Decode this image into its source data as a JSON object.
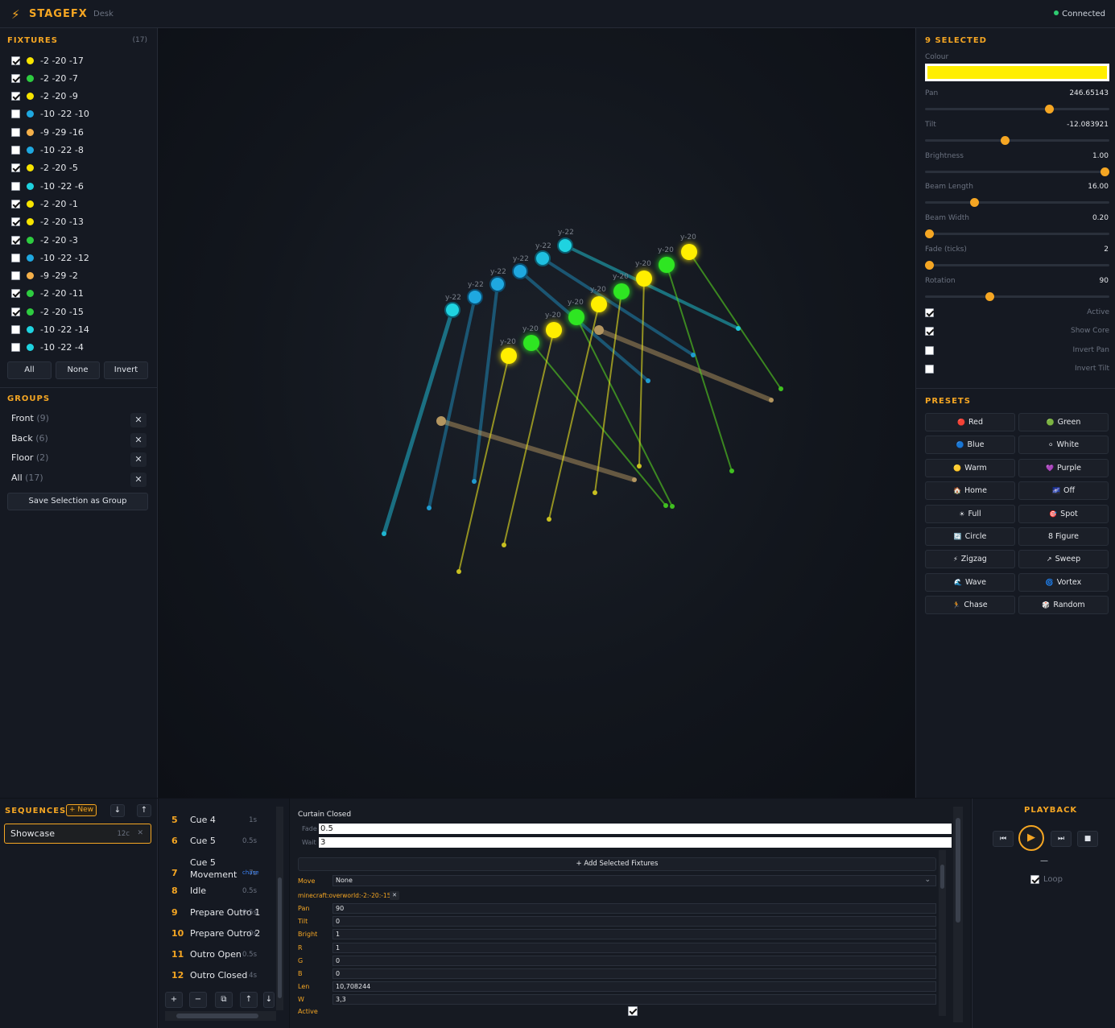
{
  "header": {
    "brand": "STAGEFX",
    "subtitle": "Desk",
    "status": "Connected",
    "logo_icon": "⚡"
  },
  "fixtures": {
    "title": "FIXTURES",
    "count": "(17)",
    "items": [
      {
        "label": "-2 -20 -17",
        "checked": true,
        "color": "#f7e400"
      },
      {
        "label": "-2 -20 -7",
        "checked": true,
        "color": "#2ecc40"
      },
      {
        "label": "-2 -20 -9",
        "checked": true,
        "color": "#f7e400"
      },
      {
        "label": "-10 -22 -10",
        "checked": false,
        "color": "#1fa8e0"
      },
      {
        "label": "-9 -29 -16",
        "checked": false,
        "color": "#f5b04a"
      },
      {
        "label": "-10 -22 -8",
        "checked": false,
        "color": "#1fa8e0"
      },
      {
        "label": "-2 -20 -5",
        "checked": true,
        "color": "#f7e400"
      },
      {
        "label": "-10 -22 -6",
        "checked": false,
        "color": "#1fd3e0"
      },
      {
        "label": "-2 -20 -1",
        "checked": true,
        "color": "#f7e400"
      },
      {
        "label": "-2 -20 -13",
        "checked": true,
        "color": "#f7e400"
      },
      {
        "label": "-2 -20 -3",
        "checked": true,
        "color": "#2ecc40"
      },
      {
        "label": "-10 -22 -12",
        "checked": false,
        "color": "#1fa8e0"
      },
      {
        "label": "-9 -29 -2",
        "checked": false,
        "color": "#f5b04a"
      },
      {
        "label": "-2 -20 -11",
        "checked": true,
        "color": "#2ecc40"
      },
      {
        "label": "-2 -20 -15",
        "checked": true,
        "color": "#2ecc40"
      },
      {
        "label": "-10 -22 -14",
        "checked": false,
        "color": "#1fd3e0"
      },
      {
        "label": "-10 -22 -4",
        "checked": false,
        "color": "#1fd3e0"
      }
    ],
    "all": "All",
    "none": "None",
    "invert": "Invert"
  },
  "groups": {
    "title": "GROUPS",
    "items": [
      {
        "name": "Front",
        "count": "(9)"
      },
      {
        "name": "Back",
        "count": "(6)"
      },
      {
        "name": "Floor",
        "count": "(2)"
      },
      {
        "name": "All",
        "count": "(17)"
      }
    ],
    "save": "Save Selection as Group",
    "close_icon": "✕"
  },
  "stage": {
    "label_a": "y-22",
    "label_b": "y-20",
    "label_c": "y-20"
  },
  "selection": {
    "title": "9 SELECTED",
    "colour_label": "Colour",
    "colour": "#ffee00",
    "props": [
      {
        "label": "Pan",
        "value": "246.65143",
        "level": 0.685
      },
      {
        "label": "Tilt",
        "value": "-12.083921",
        "level": 0.433
      },
      {
        "label": "Brightness",
        "value": "1.00",
        "level": 1.0
      },
      {
        "label": "Beam Length",
        "value": "16.00",
        "level": 0.255
      },
      {
        "label": "Beam Width",
        "value": "0.20",
        "level": 0.0
      },
      {
        "label": "Fade (ticks)",
        "value": "2",
        "level": 0.0
      },
      {
        "label": "Rotation",
        "value": "90",
        "level": 0.343
      }
    ],
    "checks": [
      {
        "label": "Active",
        "checked": true
      },
      {
        "label": "Show Core",
        "checked": true
      },
      {
        "label": "Invert Pan",
        "checked": false
      },
      {
        "label": "Invert Tilt",
        "checked": false
      }
    ]
  },
  "presets": {
    "title": "PRESETS",
    "items": [
      {
        "icon": "🔴",
        "label": "Red"
      },
      {
        "icon": "🟢",
        "label": "Green"
      },
      {
        "icon": "🔵",
        "label": "Blue"
      },
      {
        "icon": "⚪",
        "label": "White"
      },
      {
        "icon": "🟡",
        "label": "Warm"
      },
      {
        "icon": "💜",
        "label": "Purple"
      },
      {
        "icon": "🏠",
        "label": "Home"
      },
      {
        "icon": "🌌",
        "label": "Off"
      },
      {
        "icon": "☀",
        "label": "Full"
      },
      {
        "icon": "🎯",
        "label": "Spot"
      },
      {
        "icon": "🔄",
        "label": "Circle"
      },
      {
        "icon": "",
        "label": "8 Figure"
      },
      {
        "icon": "⚡",
        "label": "Zigzag"
      },
      {
        "icon": "↗",
        "label": "Sweep"
      },
      {
        "icon": "🌊",
        "label": "Wave"
      },
      {
        "icon": "🌀",
        "label": "Vortex"
      },
      {
        "icon": "🏃",
        "label": "Chase"
      },
      {
        "icon": "🎲",
        "label": "Random"
      }
    ]
  },
  "sequences": {
    "title": "SEQUENCES",
    "new": "+ New",
    "down": "↓",
    "up": "↑",
    "item_name": "Showcase",
    "item_count": "12c",
    "item_close": "✕"
  },
  "cues": [
    {
      "num": "5",
      "name": "Cue 4",
      "dur": "1s",
      "tag": ""
    },
    {
      "num": "6",
      "name": "Cue 5",
      "dur": "0.5s",
      "tag": ""
    },
    {
      "num": "7",
      "name": "Cue 5 Movement",
      "dur": "7s",
      "tag": "chase"
    },
    {
      "num": "8",
      "name": "Idle",
      "dur": "0.5s",
      "tag": ""
    },
    {
      "num": "9",
      "name": "Prepare Outro 1",
      "dur": "0.5s",
      "tag": ""
    },
    {
      "num": "10",
      "name": "Prepare Outro 2",
      "dur": "0s",
      "tag": ""
    },
    {
      "num": "11",
      "name": "Outro Open",
      "dur": "0.5s",
      "tag": ""
    },
    {
      "num": "12",
      "name": "Outro Closed",
      "dur": "4s",
      "tag": ""
    }
  ],
  "cue_tools": {
    "add": "+",
    "remove": "−",
    "copy": "⧉",
    "up": "↑",
    "down": "↓"
  },
  "editor": {
    "cue_name": "Curtain Closed",
    "fade_label": "Fade",
    "fade": "0.5",
    "wait_label": "Wait",
    "wait": "3",
    "add_fixtures": "+ Add Selected Fixtures",
    "move_label": "Move",
    "move_value": "None",
    "fixture_id": "minecraft:overworld:-2:-20:-15",
    "fixture_close": "✕",
    "fields": [
      {
        "label": "Pan",
        "value": "90"
      },
      {
        "label": "Tilt",
        "value": "0"
      },
      {
        "label": "Bright",
        "value": "1"
      },
      {
        "label": "R",
        "value": "1"
      },
      {
        "label": "G",
        "value": "0"
      },
      {
        "label": "B",
        "value": "0"
      },
      {
        "label": "Len",
        "value": "10,708244"
      },
      {
        "label": "W",
        "value": "3,3"
      }
    ],
    "active_label": "Active"
  },
  "playback": {
    "title": "PLAYBACK",
    "prev": "⏮",
    "play": "▶",
    "next": "⏭",
    "stop": "■",
    "dash": "—",
    "loop": "Loop"
  }
}
